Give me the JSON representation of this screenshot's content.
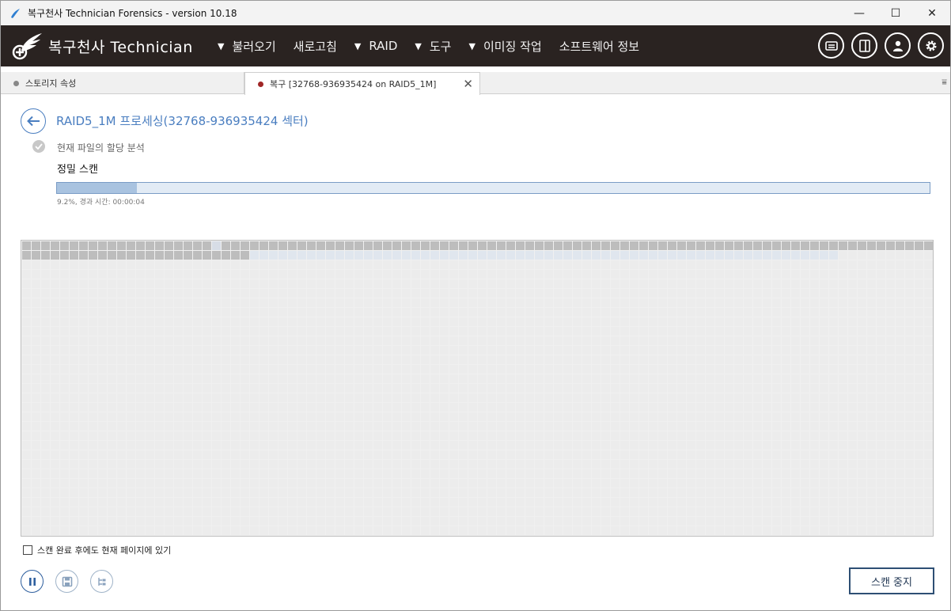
{
  "window": {
    "title": "복구천사 Technician Forensics - version 10.18",
    "controls": {
      "minimize": "—",
      "maximize": "☐",
      "close": "✕"
    }
  },
  "header": {
    "brand": "복구천사 Technician",
    "menu": [
      {
        "label": "불러오기",
        "has_arrow": true
      },
      {
        "label": "새로고침",
        "has_arrow": false
      },
      {
        "label": "RAID",
        "has_arrow": true
      },
      {
        "label": "도구",
        "has_arrow": true
      },
      {
        "label": "이미징 작업",
        "has_arrow": true
      },
      {
        "label": "소프트웨어 정보",
        "has_arrow": false
      }
    ],
    "icons": [
      "message-icon",
      "panel-icon",
      "user-icon",
      "settings-icon"
    ]
  },
  "tabs": [
    {
      "label": "스토리지 속성",
      "dot_color": "#888888"
    },
    {
      "label": "복구 [32768-936935424 on RAID5_1M]",
      "dot_color": "#a02626"
    }
  ],
  "main": {
    "title": "RAID5_1M 프로세싱(32768-936935424 섹터)",
    "step_done": "현재 파일의 할당 분석",
    "step_current": "정밀 스캔",
    "progress_fraction": 0.092,
    "progress_text": "9.2%, 경과 시간: 00:00:04"
  },
  "blockmap": {
    "blocks_per_row": 96,
    "row_count": 31,
    "scanned_count": 120,
    "highlight_index": 20,
    "partial_start": 120,
    "partial_end": 182,
    "colors": {
      "scanned": "#bdbdbd",
      "highlight": "#d7dde6",
      "partial": "#e0e6ee",
      "empty": "#ececec"
    }
  },
  "footer": {
    "keep_page_label": "스캔 완료 후에도 현재 페이지에 있기",
    "stop_button": "스캔 중지"
  }
}
